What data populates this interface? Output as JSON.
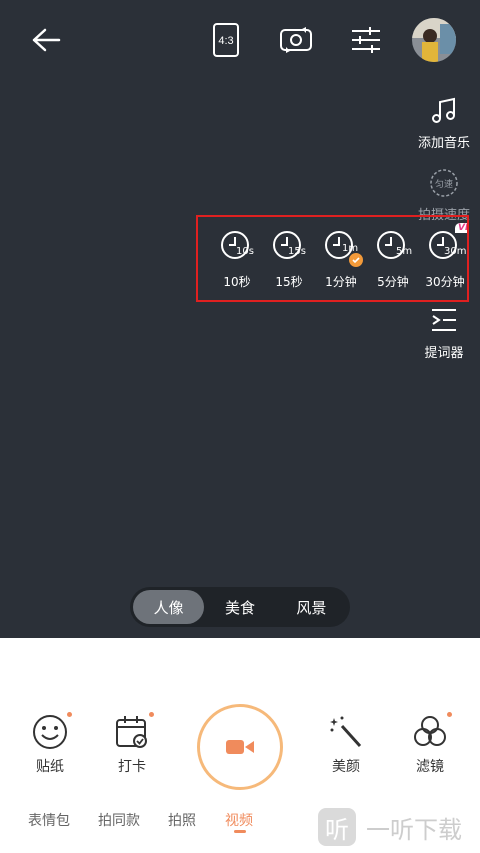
{
  "top_bar": {
    "ratio_label": "4:3"
  },
  "side_tools": {
    "music_label": "添加音乐",
    "speed_badge": "匀速",
    "speed_label": "拍摄速度",
    "prompter_label": "提词器"
  },
  "timers": [
    {
      "tag": "10s",
      "label": "10秒"
    },
    {
      "tag": "15s",
      "label": "15秒"
    },
    {
      "tag": "1m",
      "label": "1分钟",
      "selected": true
    },
    {
      "tag": "5m",
      "label": "5分钟"
    },
    {
      "tag": "30m",
      "label": "30分钟",
      "vip": "VIP"
    }
  ],
  "modes": {
    "items": [
      "人像",
      "美食",
      "风景"
    ],
    "active": "人像"
  },
  "bottom_tools": {
    "sticker": "贴纸",
    "checkin": "打卡",
    "beauty": "美颜",
    "filter": "滤镜"
  },
  "tabs": {
    "items": [
      "表情包",
      "拍同款",
      "拍照",
      "视频"
    ],
    "active": "视频"
  },
  "watermark": {
    "logo_char": "听",
    "text": "一听下载"
  },
  "colors": {
    "accent": "#f08b5c",
    "camera_bg": "#2b3038",
    "highlight_box": "#e02020"
  }
}
